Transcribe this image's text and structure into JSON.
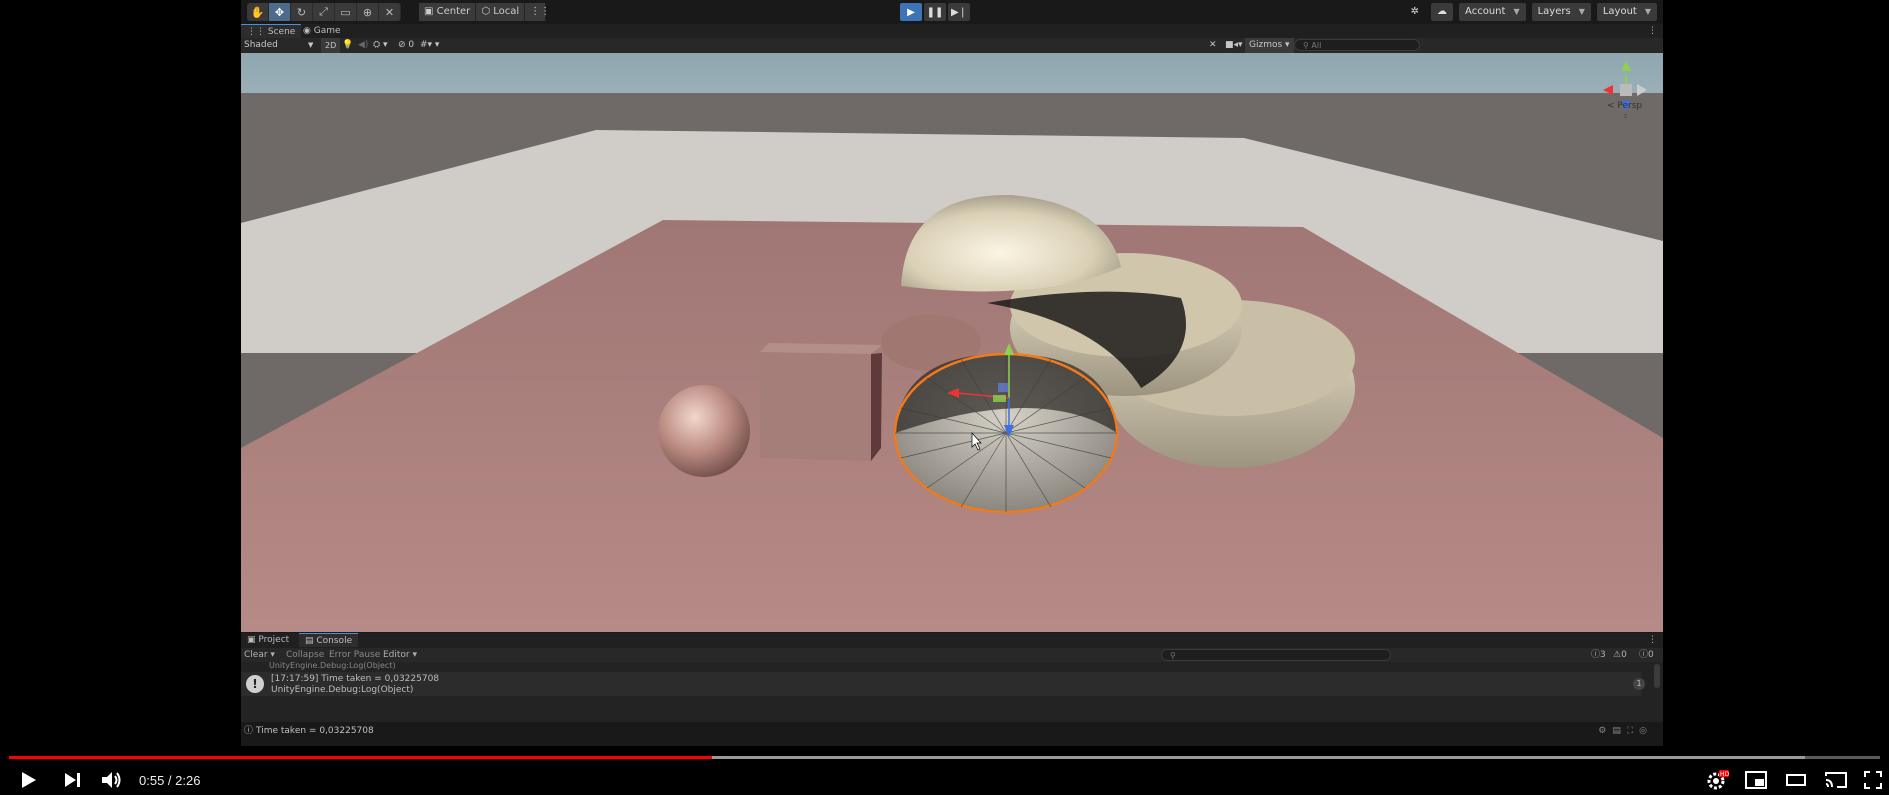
{
  "toolbar": {
    "tools": [
      "hand-tool",
      "move-tool",
      "rotate-tool",
      "scale-tool",
      "rect-tool",
      "transform-tool",
      "custom-tool"
    ],
    "pivot_mode": "Center",
    "pivot_space": "Local",
    "account_label": "Account",
    "layers_label": "Layers",
    "layout_label": "Layout"
  },
  "tabs": {
    "scene": "Scene",
    "game": "Game"
  },
  "scenebar": {
    "shading_mode": "Shaded",
    "mode_2d": "2D",
    "hidden_count": "0",
    "gizmos_label": "Gizmos",
    "search_placeholder": "All"
  },
  "viewport": {
    "projection_label": "< Persp"
  },
  "bottom_tabs": {
    "project": "Project",
    "console": "Console"
  },
  "console": {
    "clear_label": "Clear",
    "collapse_label": "Collapse",
    "error_pause_label": "Error Pause",
    "editor_label": "Editor",
    "log_count": "3",
    "warning_count": "0",
    "error_count": "0",
    "partial_entry_line": "UnityEngine.Debug:Log(Object)",
    "entry": {
      "line1": "[17:17:59] Time taken = 0,03225708",
      "line2": "UnityEngine.Debug:Log(Object)",
      "count": "1"
    }
  },
  "status_bar": {
    "message": "Time taken = 0,03225708"
  },
  "player": {
    "current_time": "0:55",
    "duration": "2:26",
    "time_display": "0:55 / 2:26",
    "progress_fraction": 0.376,
    "buffered_fraction": 0.96
  },
  "colors": {
    "accent": "#3e74b6",
    "progress": "#ff0000",
    "selection_outline": "#f07a1c"
  }
}
